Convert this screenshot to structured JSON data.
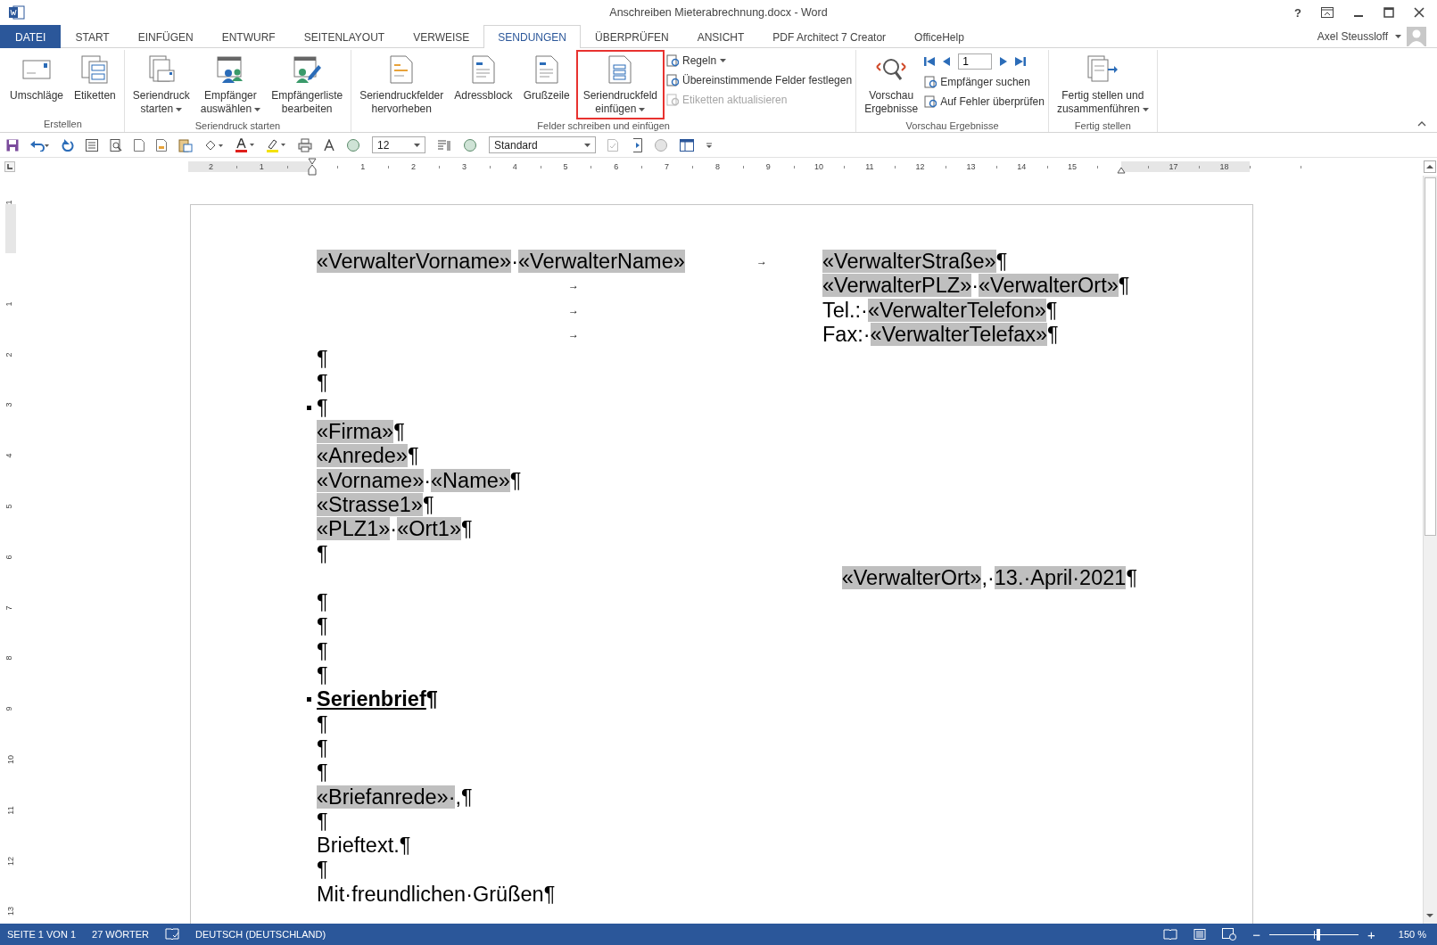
{
  "window": {
    "title": "Anschreiben Mieterabrechnung.docx - Word",
    "help": "?",
    "user": "Axel Steussloff"
  },
  "tabs": [
    {
      "label": "DATEI",
      "kind": "file",
      "selected": false
    },
    {
      "label": "START",
      "kind": "tab",
      "selected": false
    },
    {
      "label": "EINFÜGEN",
      "kind": "tab",
      "selected": false
    },
    {
      "label": "ENTWURF",
      "kind": "tab",
      "selected": false
    },
    {
      "label": "SEITENLAYOUT",
      "kind": "tab",
      "selected": false
    },
    {
      "label": "VERWEISE",
      "kind": "tab",
      "selected": false
    },
    {
      "label": "SENDUNGEN",
      "kind": "tab",
      "selected": true
    },
    {
      "label": "ÜBERPRÜFEN",
      "kind": "tab",
      "selected": false
    },
    {
      "label": "ANSICHT",
      "kind": "tab",
      "selected": false
    },
    {
      "label": "PDF Architect 7 Creator",
      "kind": "tab",
      "selected": false
    },
    {
      "label": "OfficeHelp",
      "kind": "tab",
      "selected": false
    }
  ],
  "ribbon": {
    "groups": [
      {
        "label": "Erstellen",
        "buttons": [
          {
            "lines": [
              "Umschläge"
            ],
            "dropdown": false,
            "highlighted": false
          },
          {
            "lines": [
              "Etiketten"
            ],
            "dropdown": false,
            "highlighted": false
          }
        ]
      },
      {
        "label": "Seriendruck starten",
        "buttons": [
          {
            "lines": [
              "Seriendruck",
              "starten"
            ],
            "dropdown": true,
            "highlighted": false
          },
          {
            "lines": [
              "Empfänger",
              "auswählen"
            ],
            "dropdown": true,
            "highlighted": false
          },
          {
            "lines": [
              "Empfängerliste",
              "bearbeiten"
            ],
            "dropdown": false,
            "highlighted": false
          }
        ]
      },
      {
        "label": "Felder schreiben und einfügen",
        "buttons": [
          {
            "lines": [
              "Seriendruckfelder",
              "hervorheben"
            ],
            "dropdown": false,
            "highlighted": false
          },
          {
            "lines": [
              "Adressblock"
            ],
            "dropdown": false,
            "highlighted": false
          },
          {
            "lines": [
              "Grußzeile"
            ],
            "dropdown": false,
            "highlighted": false
          },
          {
            "lines": [
              "Seriendruckfeld",
              "einfügen"
            ],
            "dropdown": true,
            "highlighted": true
          }
        ],
        "small": [
          {
            "label": "Regeln",
            "dropdown": true,
            "disabled": false
          },
          {
            "label": "Übereinstimmende Felder festlegen",
            "dropdown": false,
            "disabled": false
          },
          {
            "label": "Etiketten aktualisieren",
            "dropdown": false,
            "disabled": true
          }
        ]
      },
      {
        "label": "Vorschau Ergebnisse",
        "buttons": [
          {
            "lines": [
              "Vorschau",
              "Ergebnisse"
            ],
            "dropdown": false,
            "highlighted": false
          }
        ],
        "record": "1",
        "small": [
          {
            "label": "Empfänger suchen",
            "dropdown": false,
            "disabled": false
          },
          {
            "label": "Auf Fehler überprüfen",
            "dropdown": false,
            "disabled": false
          }
        ]
      },
      {
        "label": "Fertig stellen",
        "buttons": [
          {
            "lines": [
              "Fertig stellen und",
              "zusammenführen"
            ],
            "dropdown": true,
            "highlighted": false
          }
        ]
      }
    ]
  },
  "toolbar": {
    "font_size": "12",
    "style": "Standard"
  },
  "ruler": {
    "horizontal": [
      "2",
      "1",
      "1",
      "2",
      "3",
      "4",
      "5",
      "6",
      "7",
      "8",
      "9",
      "10",
      "11",
      "12",
      "13",
      "14",
      "15",
      "17",
      "18"
    ],
    "vertical": [
      "1",
      "1",
      "2",
      "3",
      "4",
      "5",
      "6",
      "7",
      "8",
      "9",
      "10",
      "11",
      "12",
      "13"
    ]
  },
  "header": [
    {
      "left": [
        {
          "text": "«VerwalterVorname»",
          "field": true
        },
        {
          "text": "·",
          "field": false
        },
        {
          "text": "«VerwalterName»",
          "field": true
        }
      ],
      "tab": "→",
      "right": [
        {
          "text": "«VerwalterStraße»",
          "field": true
        },
        {
          "text": "¶",
          "field": false
        }
      ]
    },
    {
      "tab": "→",
      "right": [
        {
          "text": "«VerwalterPLZ»",
          "field": true
        },
        {
          "text": "·",
          "field": false
        },
        {
          "text": "«VerwalterOrt»",
          "field": true
        },
        {
          "text": "¶",
          "field": false
        }
      ]
    },
    {
      "tab": "→",
      "right": [
        {
          "text": "Tel.:·",
          "field": false
        },
        {
          "text": "«VerwalterTelefon»",
          "field": true
        },
        {
          "text": "¶",
          "field": false
        }
      ]
    },
    {
      "tab": "→",
      "right": [
        {
          "text": "Fax:·",
          "field": false
        },
        {
          "text": "«VerwalterTelefax»",
          "field": true
        },
        {
          "text": "¶",
          "field": false
        }
      ]
    }
  ],
  "paragraphs": [
    {
      "kind": "text",
      "marked": false,
      "segments": [
        {
          "text": "¶",
          "field": false
        }
      ]
    },
    {
      "kind": "text",
      "marked": false,
      "segments": [
        {
          "text": "¶",
          "field": false
        }
      ]
    },
    {
      "kind": "text",
      "marked": true,
      "segments": [
        {
          "text": "¶",
          "field": false
        }
      ]
    },
    {
      "kind": "text",
      "marked": false,
      "segments": [
        {
          "text": "«Firma»",
          "field": true
        },
        {
          "text": "¶",
          "field": false
        }
      ]
    },
    {
      "kind": "text",
      "marked": false,
      "segments": [
        {
          "text": "«Anrede»",
          "field": true
        },
        {
          "text": "¶",
          "field": false
        }
      ]
    },
    {
      "kind": "text",
      "marked": false,
      "segments": [
        {
          "text": "«Vorname»",
          "field": true
        },
        {
          "text": "·",
          "field": false
        },
        {
          "text": "«Name»",
          "field": true
        },
        {
          "text": "¶",
          "field": false
        }
      ]
    },
    {
      "kind": "text",
      "marked": false,
      "segments": [
        {
          "text": "«Strasse1»",
          "field": true
        },
        {
          "text": "¶",
          "field": false
        }
      ]
    },
    {
      "kind": "text",
      "marked": false,
      "segments": [
        {
          "text": "«PLZ1»",
          "field": true
        },
        {
          "text": "·",
          "field": false
        },
        {
          "text": "«Ort1»",
          "field": true
        },
        {
          "text": "¶",
          "field": false
        }
      ]
    },
    {
      "kind": "text",
      "marked": false,
      "segments": [
        {
          "text": "¶",
          "field": false
        }
      ]
    },
    {
      "kind": "date",
      "marked": false,
      "segments": [
        {
          "text": "«VerwalterOrt»",
          "field": true
        },
        {
          "text": ",·",
          "field": false
        },
        {
          "text": "13.·April·2021",
          "field": true
        },
        {
          "text": "¶",
          "field": false
        }
      ]
    },
    {
      "kind": "text",
      "marked": false,
      "segments": [
        {
          "text": "¶",
          "field": false
        }
      ]
    },
    {
      "kind": "text",
      "marked": false,
      "segments": [
        {
          "text": "¶",
          "field": false
        }
      ]
    },
    {
      "kind": "text",
      "marked": false,
      "segments": [
        {
          "text": "¶",
          "field": false
        }
      ]
    },
    {
      "kind": "text",
      "marked": false,
      "segments": [
        {
          "text": "¶",
          "field": false
        }
      ]
    },
    {
      "kind": "heading",
      "marked": true,
      "segments": [
        {
          "text": "Serienbrief",
          "field": false
        },
        {
          "text": "¶",
          "field": false
        }
      ]
    },
    {
      "kind": "text",
      "marked": false,
      "segments": [
        {
          "text": "¶",
          "field": false
        }
      ]
    },
    {
      "kind": "text",
      "marked": false,
      "segments": [
        {
          "text": "¶",
          "field": false
        }
      ]
    },
    {
      "kind": "text",
      "marked": false,
      "segments": [
        {
          "text": "¶",
          "field": false
        }
      ]
    },
    {
      "kind": "text",
      "marked": false,
      "segments": [
        {
          "text": "«Briefanrede»·",
          "field": true
        },
        {
          "text": ",¶",
          "field": false
        }
      ]
    },
    {
      "kind": "text",
      "marked": false,
      "segments": [
        {
          "text": "¶",
          "field": false
        }
      ]
    },
    {
      "kind": "text",
      "marked": false,
      "segments": [
        {
          "text": "Brieftext.¶",
          "field": false
        }
      ]
    },
    {
      "kind": "text",
      "marked": false,
      "segments": [
        {
          "text": "¶",
          "field": false
        }
      ]
    },
    {
      "kind": "text",
      "marked": false,
      "segments": [
        {
          "text": "Mit·freundlichen·Grüßen¶",
          "field": false
        }
      ]
    }
  ],
  "status_bar": {
    "page": "SEITE 1 VON 1",
    "words": "27 WÖRTER",
    "language": "DEUTSCH (DEUTSCHLAND)",
    "zoom": {
      "out": "−",
      "level": 0.55,
      "in": "+",
      "reading": "150 %"
    }
  }
}
